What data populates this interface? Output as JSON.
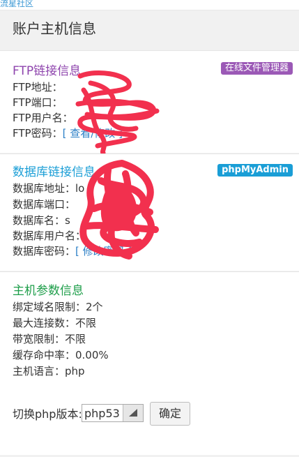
{
  "topbar": {
    "site_name": "流星社区"
  },
  "page_title": "账户主机信息",
  "ftp": {
    "title": "FTP链接信息",
    "badge": "在线文件管理器",
    "address_label": "FTP地址：",
    "port_label": "FTP端口：",
    "user_label": "FTP用户名：",
    "password_label": "FTP密码：",
    "password_link": "[ 查看/修改 ]"
  },
  "database": {
    "title": "数据库链接信息",
    "badge": "phpMyAdmin",
    "address_label": "数据库地址：",
    "address_partial": "lo",
    "port_label": "数据库端口：",
    "name_label": "数据库名：",
    "name_partial": "s",
    "user_label": "数据库用户名：",
    "password_label": "数据库密码：",
    "password_link": "[ 修改密码 ]"
  },
  "host": {
    "title": "主机参数信息",
    "rows": [
      "绑定域名限制：2个",
      "最大连接数：不限",
      "带宽限制：不限",
      "缓存命中率：0.00%",
      "主机语言：php"
    ],
    "switch_label": "切换php版本:",
    "php_selected": "php53",
    "confirm_label": "确定"
  },
  "colors": {
    "purple": "#8e44ad",
    "blue": "#1a9ed6",
    "green": "#1e9e4a",
    "scribble": "#f2304e"
  }
}
